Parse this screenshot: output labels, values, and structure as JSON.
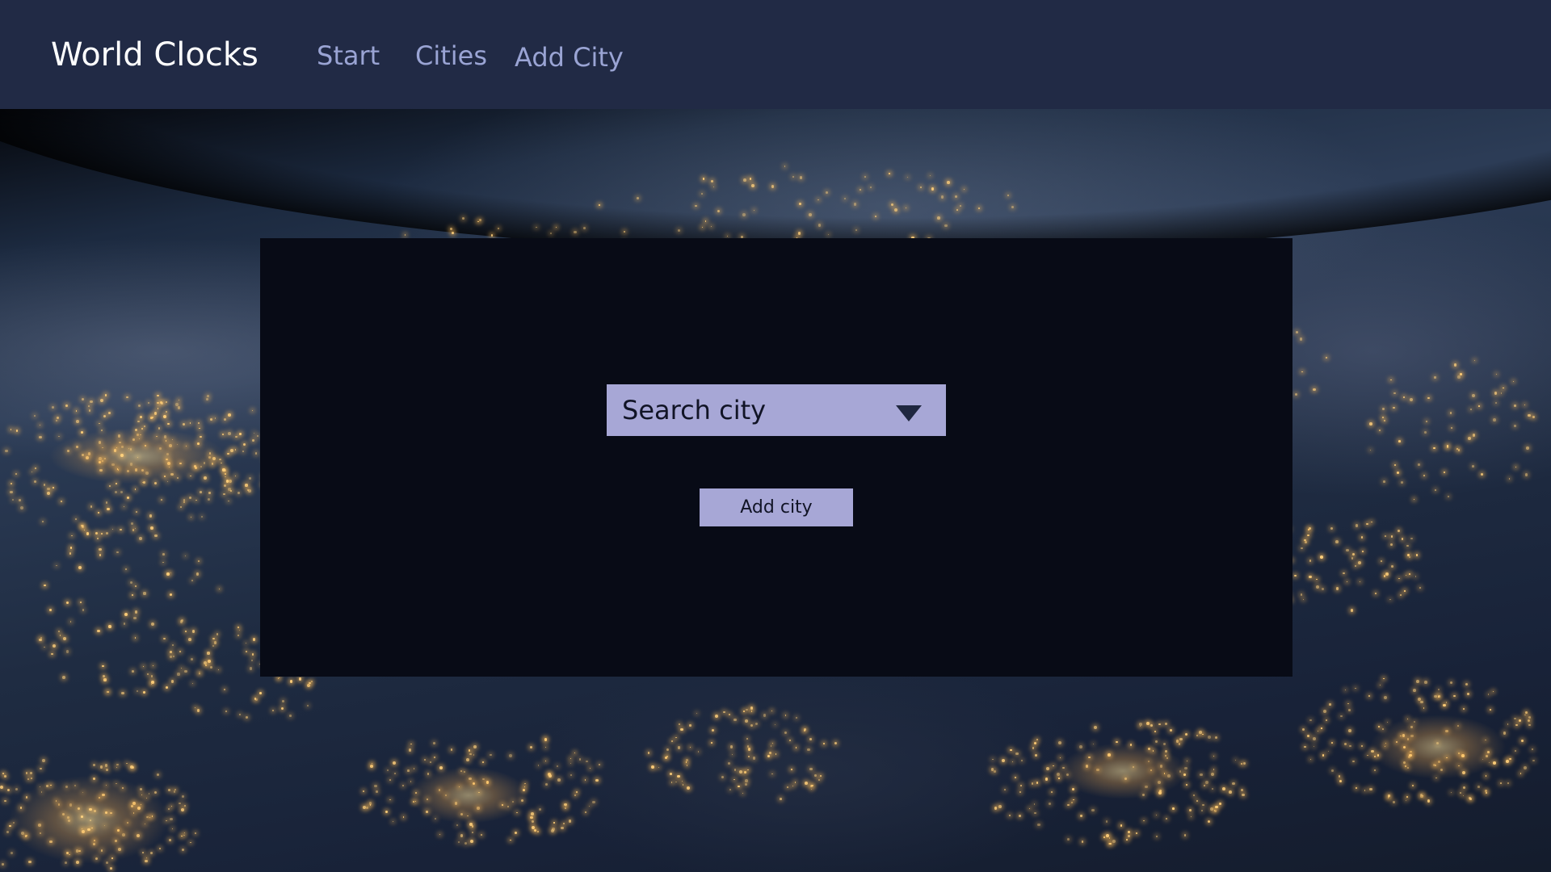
{
  "header": {
    "brand": "World Clocks",
    "nav": {
      "start": "Start",
      "cities": "Cities",
      "add_city": "Add City"
    }
  },
  "form": {
    "city_select": {
      "value": "Search city",
      "icon": "chevron-down-icon"
    },
    "add_button_label": "Add city"
  },
  "colors": {
    "header_bg": "#212a45",
    "nav_link": "#9aa4d4",
    "card_bg": "#080b16",
    "control_bg": "#a7a7d6"
  }
}
